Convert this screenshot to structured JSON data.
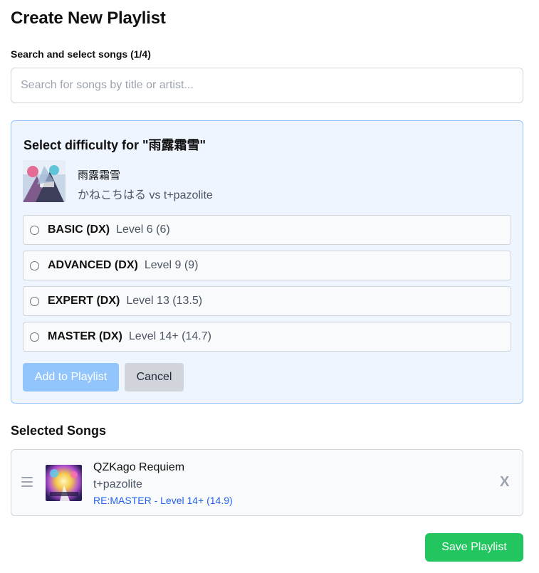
{
  "page": {
    "title": "Create New Playlist"
  },
  "search": {
    "label": "Search and select songs (1/4)",
    "placeholder": "Search for songs by title or artist...",
    "value": ""
  },
  "difficulty_panel": {
    "heading": "Select difficulty for \"雨露霜雪\"",
    "song": {
      "title": "雨露霜雪",
      "artist": "かねこちはる vs t+pazolite"
    },
    "options": [
      {
        "name": "BASIC (DX)",
        "level": "Level 6 (6)",
        "selected": false
      },
      {
        "name": "ADVANCED (DX)",
        "level": "Level 9 (9)",
        "selected": false
      },
      {
        "name": "EXPERT (DX)",
        "level": "Level 13 (13.5)",
        "selected": false
      },
      {
        "name": "MASTER (DX)",
        "level": "Level 14+ (14.7)",
        "selected": false
      }
    ],
    "add_label": "Add to Playlist",
    "cancel_label": "Cancel"
  },
  "selected_songs": {
    "heading": "Selected Songs",
    "items": [
      {
        "title": "QZKago Requiem",
        "artist": "t+pazolite",
        "difficulty": "RE:MASTER - Level 14+ (14.9)",
        "remove_label": "X"
      }
    ]
  },
  "actions": {
    "save_label": "Save Playlist"
  },
  "colors": {
    "accent_blue": "#93c5fd",
    "panel_bg": "#eef5ff",
    "link_blue": "#2563eb",
    "save_green": "#22c55e"
  },
  "icons": {
    "drag": "drag-handle-icon",
    "remove": "close-icon",
    "radio": "radio-icon"
  }
}
